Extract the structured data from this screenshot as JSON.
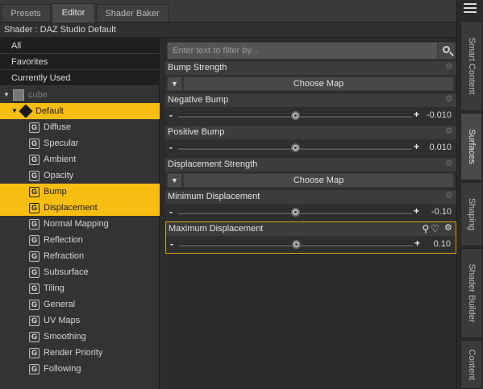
{
  "tabs": [
    {
      "label": "Presets",
      "active": false
    },
    {
      "label": "Editor",
      "active": true
    },
    {
      "label": "Shader Baker",
      "active": false
    }
  ],
  "shader_title": "Shader : DAZ Studio Default",
  "filters": [
    "All",
    "Favorites",
    "Currently Used"
  ],
  "tree": {
    "node": "cube",
    "group": "Default",
    "items": [
      "Diffuse",
      "Specular",
      "Ambient",
      "Opacity",
      "Bump",
      "Displacement",
      "Normal Mapping",
      "Reflection",
      "Refraction",
      "Subsurface",
      "Tiling",
      "General",
      "UV Maps",
      "Smoothing",
      "Render Priority",
      "Following"
    ],
    "selected": [
      "Bump",
      "Displacement"
    ]
  },
  "search": {
    "placeholder": "Enter text to filter by..."
  },
  "properties": [
    {
      "title": "Bump Strength",
      "type": "map",
      "button": "Choose Map"
    },
    {
      "title": "Negative Bump",
      "type": "slider",
      "value": "-0.010"
    },
    {
      "title": "Positive Bump",
      "type": "slider",
      "value": "0.010"
    },
    {
      "title": "Displacement Strength",
      "type": "map",
      "button": "Choose Map"
    },
    {
      "title": "Minimum Displacement",
      "type": "slider",
      "value": "-0.10"
    },
    {
      "title": "Maximum Displacement",
      "type": "slider",
      "value": "0.10",
      "highlighted": true
    }
  ],
  "side_tabs": [
    "Smart Content",
    "Surfaces",
    "Shaping",
    "Shader Builder",
    "Content"
  ],
  "colors": {
    "selection": "#f7be12",
    "highlight_border": "#d9a510",
    "panel": "#2b2b2b"
  }
}
